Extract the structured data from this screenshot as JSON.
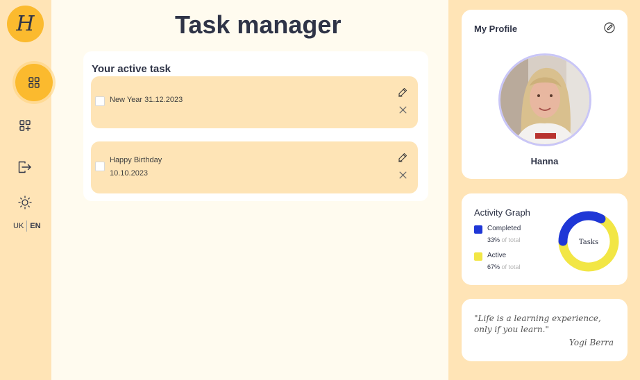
{
  "sidebar": {
    "logo_letter": "H",
    "lang": {
      "uk": "UK",
      "en": "EN"
    },
    "icons": [
      "dashboard-icon",
      "add-grid-icon",
      "logout-icon",
      "sun-icon"
    ]
  },
  "main": {
    "title": "Task manager",
    "panel_title": "Your active task",
    "tasks": [
      {
        "lines": [
          "New Year 31.12.2023"
        ]
      },
      {
        "lines": [
          "Happy Birthday",
          "10.10.2023"
        ]
      }
    ]
  },
  "profile": {
    "title": "My Profile",
    "name": "Hanna"
  },
  "activity": {
    "title": "Activity Graph",
    "center_label": "Tasks",
    "colors": {
      "completed": "#1f37d6",
      "active": "#f2e645"
    },
    "legend": [
      {
        "label": "Completed",
        "pct": "33%",
        "suffix": "of total"
      },
      {
        "label": "Active",
        "pct": "67%",
        "suffix": "of total"
      }
    ]
  },
  "chart_data": {
    "type": "pie",
    "categories": [
      "Completed",
      "Active"
    ],
    "values": [
      33,
      67
    ]
  },
  "quote": {
    "line1": "\"Life is a learning experience,",
    "line2": "only if you learn.\"",
    "author": "Yogi Berra"
  }
}
